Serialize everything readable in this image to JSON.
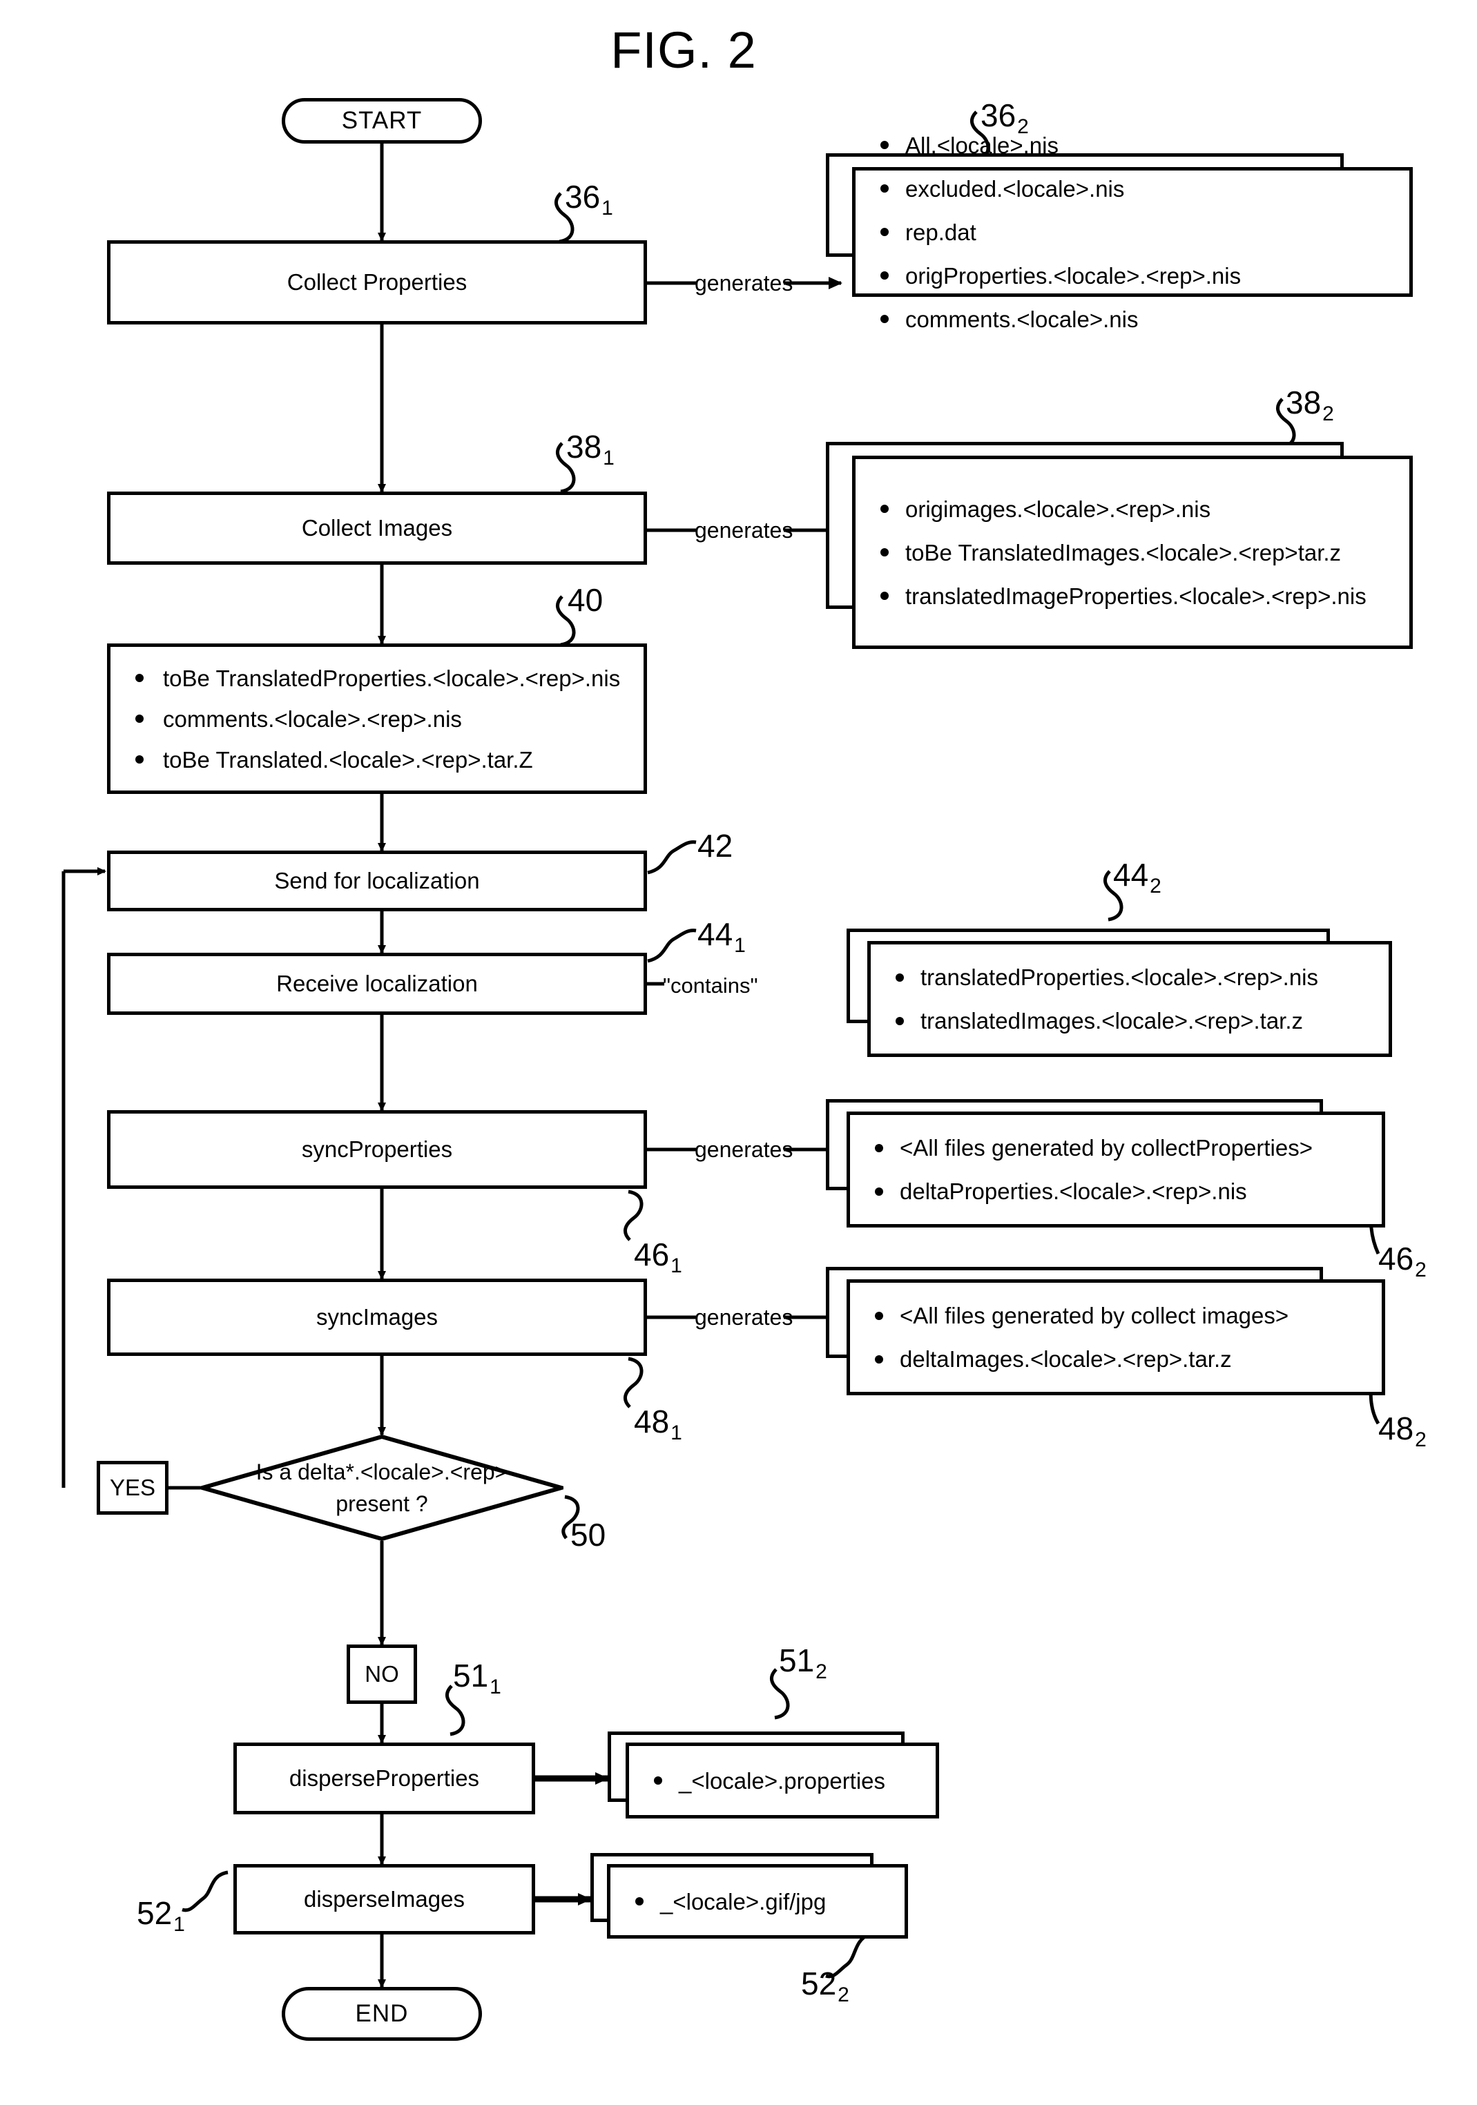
{
  "figure": {
    "title": "FIG. 2"
  },
  "terminals": {
    "start": "START",
    "end": "END"
  },
  "process": {
    "collect_properties": "Collect Properties",
    "collect_images": "Collect Images",
    "send_for_localization": "Send for localization",
    "receive_localization": "Receive localization",
    "sync_properties": "syncProperties",
    "sync_images": "syncImages",
    "disperse_properties": "disperseProperties",
    "disperse_images": "disperseImages"
  },
  "decision": {
    "line1": "Is a delta*.<locale>.<rep>",
    "line2": "present ?",
    "yes": "YES",
    "no": "NO"
  },
  "edges": {
    "generates": "generates",
    "contains": "\"contains\""
  },
  "artifacts": {
    "collect_properties_out": [
      "All.<locale>.nis",
      "excluded.<locale>.nis",
      "rep.dat",
      "origProperties.<locale>.<rep>.nis",
      "comments.<locale>.nis"
    ],
    "collect_images_out": [
      "origimages.<locale>.<rep>.nis",
      "toBe TranslatedImages.<locale>.<rep>tar.z",
      "translatedImageProperties.<locale>.<rep>.nis"
    ],
    "to_be_translated": [
      "toBe TranslatedProperties.<locale>.<rep>.nis",
      "comments.<locale>.<rep>.nis",
      "toBe Translated.<locale>.<rep>.tar.Z"
    ],
    "receive_localization_contains": [
      "translatedProperties.<locale>.<rep>.nis",
      "translatedImages.<locale>.<rep>.tar.z"
    ],
    "sync_properties_out": [
      "<All files generated by collectProperties>",
      "deltaProperties.<locale>.<rep>.nis"
    ],
    "sync_images_out": [
      "<All files generated by collect images>",
      "deltaImages.<locale>.<rep>.tar.z"
    ],
    "disperse_properties_out": [
      "_<locale>.properties"
    ],
    "disperse_images_out": [
      "_<locale>.gif/jpg"
    ]
  },
  "refnums": {
    "r36_1_base": "36",
    "r36_1_sub": "1",
    "r36_2_base": "36",
    "r36_2_sub": "2",
    "r38_1_base": "38",
    "r38_1_sub": "1",
    "r38_2_base": "38",
    "r38_2_sub": "2",
    "r40": "40",
    "r42": "42",
    "r44_1_base": "44",
    "r44_1_sub": "1",
    "r44_2_base": "44",
    "r44_2_sub": "2",
    "r46_1_base": "46",
    "r46_1_sub": "1",
    "r46_2_base": "46",
    "r46_2_sub": "2",
    "r48_1_base": "48",
    "r48_1_sub": "1",
    "r48_2_base": "48",
    "r48_2_sub": "2",
    "r50": "50",
    "r51_1_base": "51",
    "r51_1_sub": "1",
    "r51_2_base": "51",
    "r51_2_sub": "2",
    "r52_1_base": "52",
    "r52_1_sub": "1",
    "r52_2_base": "52",
    "r52_2_sub": "2"
  }
}
